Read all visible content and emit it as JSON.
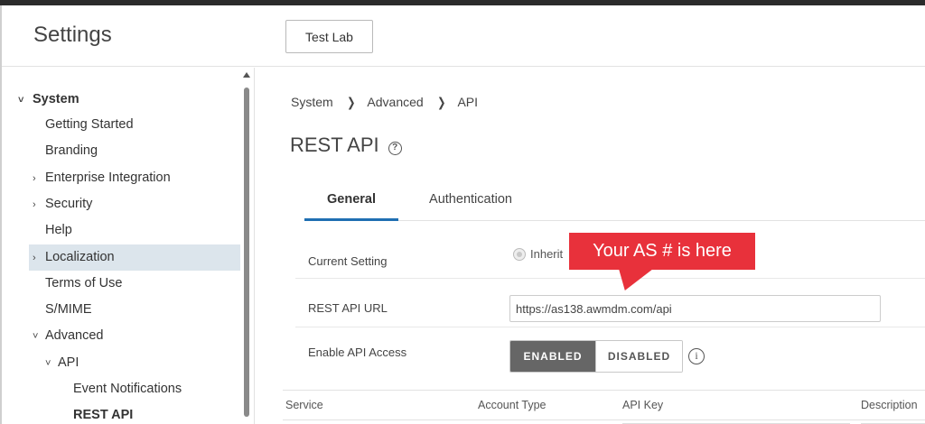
{
  "header": {
    "title": "Settings",
    "test_lab_label": "Test Lab"
  },
  "sidebar": {
    "items": [
      {
        "label": "System",
        "chevron": "˅"
      },
      {
        "label": "Getting Started",
        "chevron": ""
      },
      {
        "label": "Branding",
        "chevron": ""
      },
      {
        "label": "Enterprise Integration",
        "chevron": "›"
      },
      {
        "label": "Security",
        "chevron": "›"
      },
      {
        "label": "Help",
        "chevron": ""
      },
      {
        "label": "Localization",
        "chevron": "›"
      },
      {
        "label": "Terms of Use",
        "chevron": ""
      },
      {
        "label": "S/MIME",
        "chevron": ""
      },
      {
        "label": "Advanced",
        "chevron": "˅"
      },
      {
        "label": "API",
        "chevron": "˅"
      },
      {
        "label": "Event Notifications",
        "chevron": ""
      },
      {
        "label": "REST API",
        "chevron": ""
      }
    ]
  },
  "breadcrumb": {
    "items": [
      "System",
      "Advanced",
      "API"
    ],
    "separator": "❯"
  },
  "page": {
    "title": "REST API",
    "help_glyph": "?"
  },
  "tabs": [
    {
      "label": "General",
      "active": true
    },
    {
      "label": "Authentication",
      "active": false
    }
  ],
  "form": {
    "current_setting_label": "Current Setting",
    "inherit_label": "Inherit",
    "rest_api_url_label": "REST API URL",
    "rest_api_url_value": "https://as138.awmdm.com/api",
    "enable_api_access_label": "Enable API Access",
    "enabled_label": "ENABLED",
    "disabled_label": "DISABLED",
    "enable_api_access_value": "ENABLED",
    "info_glyph": "i"
  },
  "table": {
    "columns": [
      "Service",
      "Account Type",
      "API Key",
      "Description"
    ]
  },
  "callout": {
    "text": "Your AS # is here",
    "color": "#e8313b"
  },
  "colors": {
    "active_tab": "#1f6fb2",
    "active_nav_bg": "#dce5ec",
    "enabled_bg": "#666666"
  }
}
